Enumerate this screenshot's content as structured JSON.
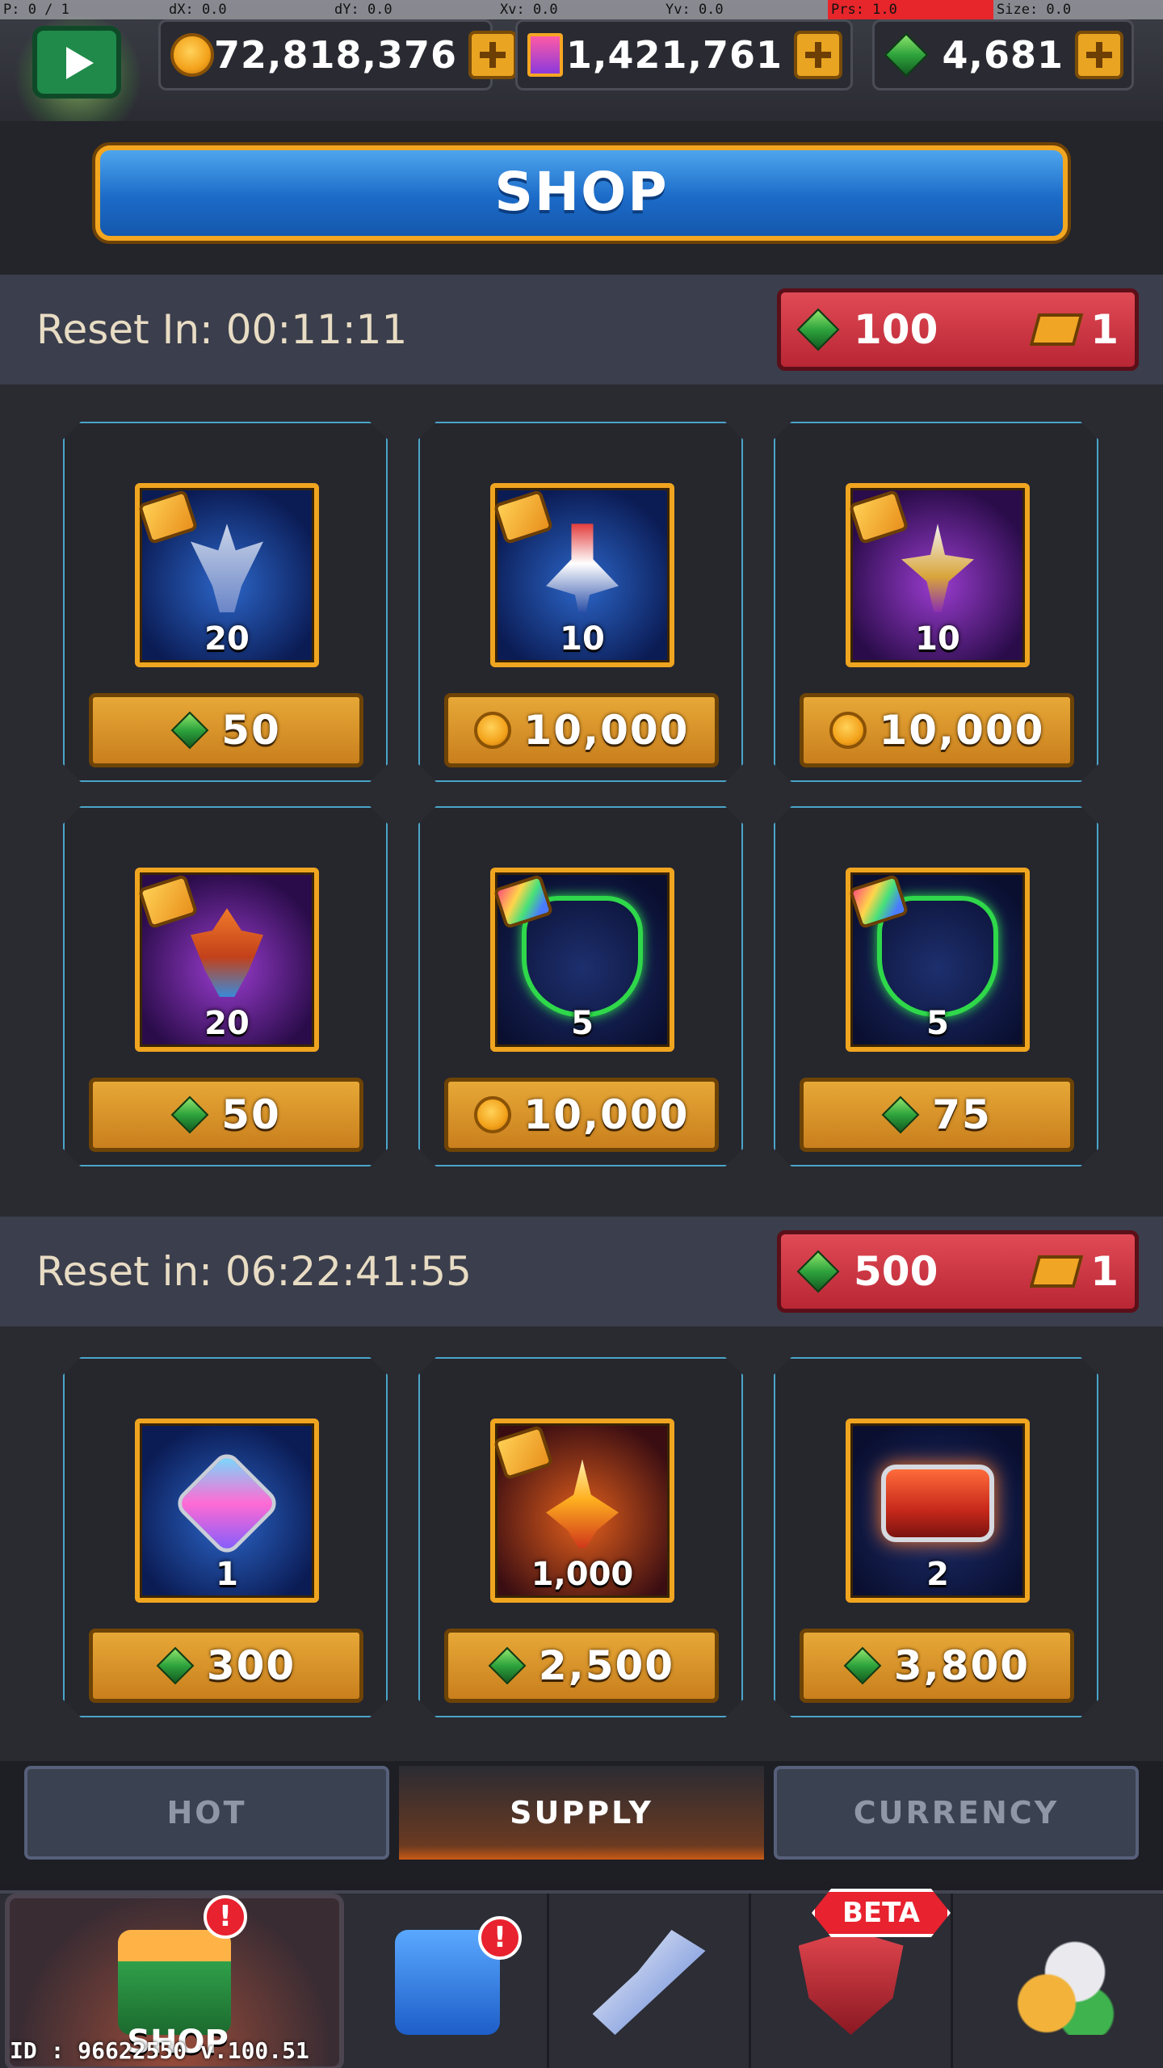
{
  "debug": {
    "p": "P: 0 / 1",
    "dx": "dX: 0.0",
    "dy": "dY: 0.0",
    "xv": "Xv: 0.0",
    "yv": "Yv: 0.0",
    "prs": "Prs: 1.0",
    "size": "Size: 0.0"
  },
  "currencies": {
    "coins": "72,818,376",
    "cards": "1,421,761",
    "gems": "4,681"
  },
  "header": {
    "title": "SHOP"
  },
  "section1": {
    "reset_text": "Reset In: 00:11:11",
    "refresh_cost": "100",
    "ticket_count": "1",
    "items": [
      {
        "qty": "20",
        "price": "50",
        "currency": "gem"
      },
      {
        "qty": "10",
        "price": "10,000",
        "currency": "coin"
      },
      {
        "qty": "10",
        "price": "10,000",
        "currency": "coin"
      },
      {
        "qty": "20",
        "price": "50",
        "currency": "gem"
      },
      {
        "qty": "5",
        "price": "10,000",
        "currency": "coin"
      },
      {
        "qty": "5",
        "price": "75",
        "currency": "gem"
      }
    ]
  },
  "section2": {
    "reset_text": "Reset in: 06:22:41:55",
    "refresh_cost": "500",
    "ticket_count": "1",
    "items": [
      {
        "qty": "1",
        "price": "300",
        "currency": "gem"
      },
      {
        "qty": "1,000",
        "price": "2,500",
        "currency": "gem"
      },
      {
        "qty": "2",
        "price": "3,800",
        "currency": "gem"
      }
    ]
  },
  "tabs": {
    "hot": "HOT",
    "supply": "SUPPLY",
    "currency": "CURRENCY"
  },
  "nav": {
    "shop_label": "SHOP",
    "beta": "BETA",
    "badge": "!"
  },
  "footer": {
    "id": "ID : 96622550 v.100.51"
  }
}
